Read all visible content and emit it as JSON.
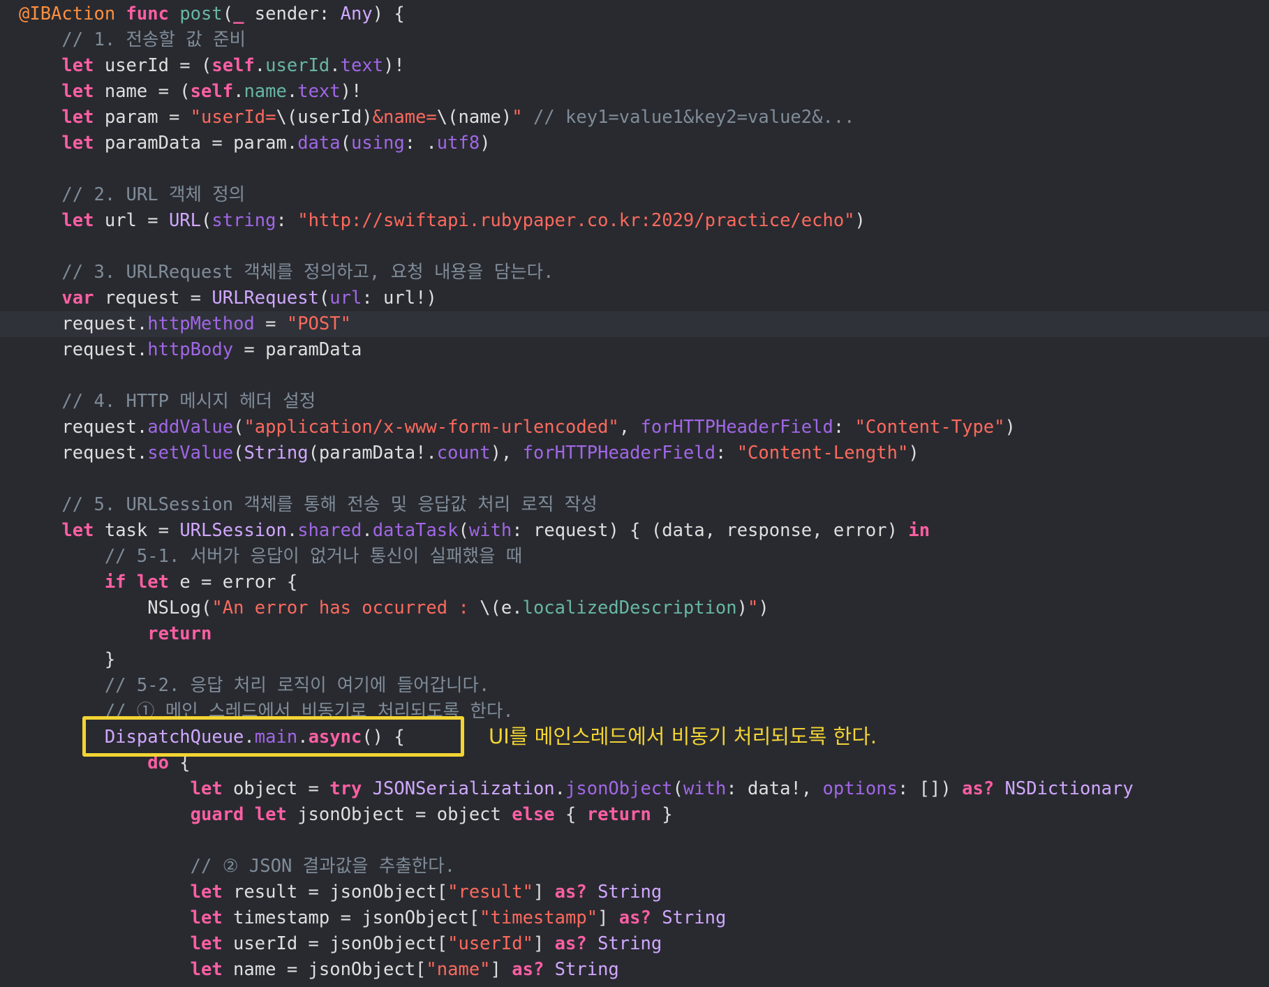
{
  "editor": {
    "language": "swift",
    "theme": "xcode-default-dark",
    "colors": {
      "background": "#292a30",
      "current_line": "#2f3239",
      "keyword": "#fc5fa3",
      "comment": "#7f8c98",
      "string": "#fc6a5d",
      "type": "#d0a8ff",
      "function": "#67b7a4",
      "member": "#a167e6",
      "attribute": "#fd8f3f",
      "plain": "#dfdfe0",
      "annotation": "#f3d433"
    },
    "current_line_index": 12,
    "lines": [
      {
        "indent": "",
        "tokens": [
          [
            "@IBAction",
            "attr"
          ],
          [
            " ",
            "pl"
          ],
          [
            "func",
            "kw"
          ],
          [
            " ",
            "pl"
          ],
          [
            "post",
            "fn"
          ],
          [
            "(",
            "pl"
          ],
          [
            "_",
            "kw"
          ],
          [
            " sender: ",
            "pl"
          ],
          [
            "Any",
            "ty"
          ],
          [
            ") {",
            "pl"
          ]
        ]
      },
      {
        "indent": "    ",
        "tokens": [
          [
            "// 1. 전송할 값 준비",
            "cm"
          ]
        ]
      },
      {
        "indent": "    ",
        "tokens": [
          [
            "let",
            "kw"
          ],
          [
            " userId = (",
            "pl"
          ],
          [
            "self",
            "kw"
          ],
          [
            ".",
            "pl"
          ],
          [
            "userId",
            "fn"
          ],
          [
            ".",
            "pl"
          ],
          [
            "text",
            "mem"
          ],
          [
            ")!",
            "pl"
          ]
        ]
      },
      {
        "indent": "    ",
        "tokens": [
          [
            "let",
            "kw"
          ],
          [
            " name = (",
            "pl"
          ],
          [
            "self",
            "kw"
          ],
          [
            ".",
            "pl"
          ],
          [
            "name",
            "fn"
          ],
          [
            ".",
            "pl"
          ],
          [
            "text",
            "mem"
          ],
          [
            ")!",
            "pl"
          ]
        ]
      },
      {
        "indent": "    ",
        "tokens": [
          [
            "let",
            "kw"
          ],
          [
            " param = ",
            "pl"
          ],
          [
            "\"userId=",
            "str"
          ],
          [
            "\\(userId)",
            "pl"
          ],
          [
            "&name=",
            "str"
          ],
          [
            "\\(name)",
            "pl"
          ],
          [
            "\"",
            "str"
          ],
          [
            " ",
            "pl"
          ],
          [
            "// key1=value1&key2=value2&...",
            "cm"
          ]
        ]
      },
      {
        "indent": "    ",
        "tokens": [
          [
            "let",
            "kw"
          ],
          [
            " paramData = param.",
            "pl"
          ],
          [
            "data",
            "mem"
          ],
          [
            "(",
            "pl"
          ],
          [
            "using",
            "mem"
          ],
          [
            ": .",
            "pl"
          ],
          [
            "utf8",
            "mem"
          ],
          [
            ")",
            "pl"
          ]
        ]
      },
      {
        "indent": "",
        "tokens": []
      },
      {
        "indent": "    ",
        "tokens": [
          [
            "// 2. URL 객체 정의",
            "cm"
          ]
        ]
      },
      {
        "indent": "    ",
        "tokens": [
          [
            "let",
            "kw"
          ],
          [
            " url = ",
            "pl"
          ],
          [
            "URL",
            "ty"
          ],
          [
            "(",
            "pl"
          ],
          [
            "string",
            "mem"
          ],
          [
            ": ",
            "pl"
          ],
          [
            "\"http://swiftapi.rubypaper.co.kr:2029/practice/echo\"",
            "str"
          ],
          [
            ")",
            "pl"
          ]
        ]
      },
      {
        "indent": "",
        "tokens": []
      },
      {
        "indent": "    ",
        "tokens": [
          [
            "// 3. URLRequest 객체를 정의하고, 요청 내용을 담는다.",
            "cm"
          ]
        ]
      },
      {
        "indent": "    ",
        "tokens": [
          [
            "var",
            "kw"
          ],
          [
            " request = ",
            "pl"
          ],
          [
            "URLRequest",
            "ty"
          ],
          [
            "(",
            "pl"
          ],
          [
            "url",
            "mem"
          ],
          [
            ": url!)",
            "pl"
          ]
        ]
      },
      {
        "indent": "    ",
        "tokens": [
          [
            "request.",
            "pl"
          ],
          [
            "httpMethod",
            "mem"
          ],
          [
            " = ",
            "pl"
          ],
          [
            "\"POST\"",
            "str"
          ]
        ]
      },
      {
        "indent": "    ",
        "tokens": [
          [
            "request.",
            "pl"
          ],
          [
            "httpBody",
            "mem"
          ],
          [
            " = paramData",
            "pl"
          ]
        ]
      },
      {
        "indent": "",
        "tokens": []
      },
      {
        "indent": "    ",
        "tokens": [
          [
            "// 4. HTTP 메시지 헤더 설정",
            "cm"
          ]
        ]
      },
      {
        "indent": "    ",
        "tokens": [
          [
            "request.",
            "pl"
          ],
          [
            "addValue",
            "mem"
          ],
          [
            "(",
            "pl"
          ],
          [
            "\"application/x-www-form-urlencoded\"",
            "str"
          ],
          [
            ", ",
            "pl"
          ],
          [
            "forHTTPHeaderField",
            "mem"
          ],
          [
            ": ",
            "pl"
          ],
          [
            "\"Content-Type\"",
            "str"
          ],
          [
            ")",
            "pl"
          ]
        ]
      },
      {
        "indent": "    ",
        "tokens": [
          [
            "request.",
            "pl"
          ],
          [
            "setValue",
            "mem"
          ],
          [
            "(",
            "pl"
          ],
          [
            "String",
            "ty"
          ],
          [
            "(paramData!.",
            "pl"
          ],
          [
            "count",
            "mem"
          ],
          [
            "), ",
            "pl"
          ],
          [
            "forHTTPHeaderField",
            "mem"
          ],
          [
            ": ",
            "pl"
          ],
          [
            "\"Content-Length\"",
            "str"
          ],
          [
            ")",
            "pl"
          ]
        ]
      },
      {
        "indent": "",
        "tokens": []
      },
      {
        "indent": "    ",
        "tokens": [
          [
            "// 5. URLSession 객체를 통해 전송 및 응답값 처리 로직 작성",
            "cm"
          ]
        ]
      },
      {
        "indent": "    ",
        "tokens": [
          [
            "let",
            "kw"
          ],
          [
            " task = ",
            "pl"
          ],
          [
            "URLSession",
            "ty"
          ],
          [
            ".",
            "pl"
          ],
          [
            "shared",
            "mem"
          ],
          [
            ".",
            "pl"
          ],
          [
            "dataTask",
            "mem"
          ],
          [
            "(",
            "pl"
          ],
          [
            "with",
            "mem"
          ],
          [
            ": request) { (data, response, error) ",
            "pl"
          ],
          [
            "in",
            "kw"
          ]
        ]
      },
      {
        "indent": "        ",
        "tokens": [
          [
            "// 5-1. 서버가 응답이 없거나 통신이 실패했을 때",
            "cm"
          ]
        ]
      },
      {
        "indent": "        ",
        "tokens": [
          [
            "if",
            "kw"
          ],
          [
            " ",
            "pl"
          ],
          [
            "let",
            "kw"
          ],
          [
            " e = error {",
            "pl"
          ]
        ]
      },
      {
        "indent": "            ",
        "tokens": [
          [
            "NSLog",
            "pl"
          ],
          [
            "(",
            "pl"
          ],
          [
            "\"An error has occurred : ",
            "str"
          ],
          [
            "\\(e.",
            "pl"
          ],
          [
            "localizedDescription",
            "fn"
          ],
          [
            ")",
            "pl"
          ],
          [
            "\"",
            "str"
          ],
          [
            ")",
            "pl"
          ]
        ]
      },
      {
        "indent": "            ",
        "tokens": [
          [
            "return",
            "kw"
          ]
        ]
      },
      {
        "indent": "        ",
        "tokens": [
          [
            "}",
            "pl"
          ]
        ]
      },
      {
        "indent": "        ",
        "tokens": [
          [
            "// 5-2. 응답 처리 로직이 여기에 들어갑니다.",
            "cm"
          ]
        ]
      },
      {
        "indent": "        ",
        "tokens": [
          [
            "// ① 메인 스레드에서 비동기로 처리되도록 한다.",
            "cm"
          ]
        ]
      },
      {
        "indent": "        ",
        "tokens": [
          [
            "DispatchQueue",
            "ty"
          ],
          [
            ".",
            "pl"
          ],
          [
            "main",
            "mem"
          ],
          [
            ".",
            "pl"
          ],
          [
            "async",
            "kw"
          ],
          [
            "() {",
            "pl"
          ]
        ]
      },
      {
        "indent": "            ",
        "tokens": [
          [
            "do",
            "kw"
          ],
          [
            " {",
            "pl"
          ]
        ]
      },
      {
        "indent": "                ",
        "tokens": [
          [
            "let",
            "kw"
          ],
          [
            " object = ",
            "pl"
          ],
          [
            "try",
            "kw"
          ],
          [
            " ",
            "pl"
          ],
          [
            "JSONSerialization",
            "ty"
          ],
          [
            ".",
            "pl"
          ],
          [
            "jsonObject",
            "mem"
          ],
          [
            "(",
            "pl"
          ],
          [
            "with",
            "mem"
          ],
          [
            ": data!, ",
            "pl"
          ],
          [
            "options",
            "mem"
          ],
          [
            ": []) ",
            "pl"
          ],
          [
            "as?",
            "kw"
          ],
          [
            " ",
            "pl"
          ],
          [
            "NSDictionary",
            "ty"
          ]
        ]
      },
      {
        "indent": "                ",
        "tokens": [
          [
            "guard",
            "kw"
          ],
          [
            " ",
            "pl"
          ],
          [
            "let",
            "kw"
          ],
          [
            " jsonObject = object ",
            "pl"
          ],
          [
            "else",
            "kw"
          ],
          [
            " { ",
            "pl"
          ],
          [
            "return",
            "kw"
          ],
          [
            " }",
            "pl"
          ]
        ]
      },
      {
        "indent": "",
        "tokens": []
      },
      {
        "indent": "                ",
        "tokens": [
          [
            "// ② JSON 결과값을 추출한다.",
            "cm"
          ]
        ]
      },
      {
        "indent": "                ",
        "tokens": [
          [
            "let",
            "kw"
          ],
          [
            " result = jsonObject[",
            "pl"
          ],
          [
            "\"result\"",
            "str"
          ],
          [
            "] ",
            "pl"
          ],
          [
            "as?",
            "kw"
          ],
          [
            " ",
            "pl"
          ],
          [
            "String",
            "ty"
          ]
        ]
      },
      {
        "indent": "                ",
        "tokens": [
          [
            "let",
            "kw"
          ],
          [
            " timestamp = jsonObject[",
            "pl"
          ],
          [
            "\"timestamp\"",
            "str"
          ],
          [
            "] ",
            "pl"
          ],
          [
            "as?",
            "kw"
          ],
          [
            " ",
            "pl"
          ],
          [
            "String",
            "ty"
          ]
        ]
      },
      {
        "indent": "                ",
        "tokens": [
          [
            "let",
            "kw"
          ],
          [
            " userId = jsonObject[",
            "pl"
          ],
          [
            "\"userId\"",
            "str"
          ],
          [
            "] ",
            "pl"
          ],
          [
            "as?",
            "kw"
          ],
          [
            " ",
            "pl"
          ],
          [
            "String",
            "ty"
          ]
        ]
      },
      {
        "indent": "                ",
        "tokens": [
          [
            "let",
            "kw"
          ],
          [
            " name = jsonObject[",
            "pl"
          ],
          [
            "\"name\"",
            "str"
          ],
          [
            "] ",
            "pl"
          ],
          [
            "as?",
            "kw"
          ],
          [
            " ",
            "pl"
          ],
          [
            "String",
            "ty"
          ]
        ]
      }
    ]
  },
  "annotation": {
    "text": "UI를 메인스레드에서 비동기 처리되도록 한다.",
    "target_line_index": 28
  }
}
